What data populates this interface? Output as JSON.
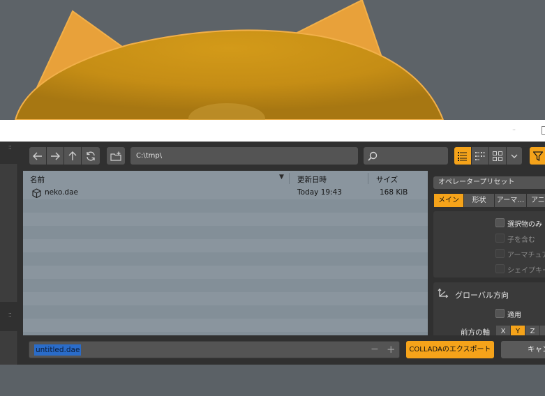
{
  "window": {
    "dots": "··"
  },
  "toolbar": {
    "back_icon": "arrow-left-icon",
    "forward_icon": "arrow-right-icon",
    "parent_icon": "arrow-up-icon",
    "refresh_icon": "refresh-icon",
    "new_folder_icon": "new-folder-icon",
    "path": "C:\\tmp\\",
    "search_placeholder": "",
    "view_icons": [
      "list-view-icon",
      "short-list-view-icon",
      "thumbnail-view-icon"
    ],
    "filter_icon": "filter-icon"
  },
  "file_list": {
    "columns": {
      "name": "名前",
      "modified": "更新日時",
      "size": "サイズ"
    },
    "rows": [
      {
        "icon": "mesh-file-icon",
        "name": "neko.dae",
        "modified": "Today 19:43",
        "size": "168 KiB"
      }
    ]
  },
  "sidebar": {
    "preset": "オペレータープリセット",
    "tabs": [
      "メイン",
      "形状",
      "アーマ…",
      "アニ"
    ],
    "active_tab": "メイン",
    "options": [
      {
        "label": "選択物のみ",
        "checked": false,
        "enabled": true
      },
      {
        "label": "子を含む",
        "checked": false,
        "enabled": false
      },
      {
        "label": "アーマチュア",
        "checked": false,
        "enabled": false
      },
      {
        "label": "シェイプキー",
        "checked": false,
        "enabled": false
      }
    ],
    "global_orientation": {
      "title": "グローバル方向",
      "icon": "orientation-icon",
      "apply_label": "適用",
      "forward_axis_label": "前方の軸",
      "axes": [
        "X",
        "Y",
        "Z",
        "-"
      ],
      "selected_axis": "Y"
    }
  },
  "bottom": {
    "filename": "untitled.dae",
    "minus": "−",
    "plus": "+",
    "export_label": "COLLADAのエクスポート",
    "cancel_label": "キャンセル"
  },
  "colors": {
    "accent": "#f5a31a",
    "file_area": "#87939c",
    "model_orange": "#e8a13a"
  }
}
